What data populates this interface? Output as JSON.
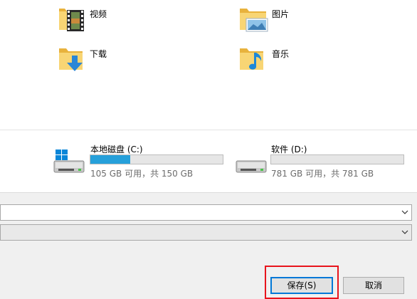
{
  "folders": [
    {
      "label": "视频",
      "icon": "video-folder-icon"
    },
    {
      "label": "图片",
      "icon": "pictures-folder-icon"
    },
    {
      "label": "下载",
      "icon": "downloads-folder-icon"
    },
    {
      "label": "音乐",
      "icon": "music-folder-icon"
    }
  ],
  "drives": [
    {
      "name": "本地磁盘 (C:)",
      "size": "105 GB 可用，共 150 GB",
      "used_fraction": 0.3,
      "icon": "windows-drive-icon"
    },
    {
      "name": "软件 (D:)",
      "size": "781 GB 可用，共 781 GB",
      "used_fraction": 0.0,
      "icon": "drive-icon"
    }
  ],
  "dialog": {
    "filename_value": "",
    "filetype_value": "",
    "save_label": "保存(S)",
    "cancel_label": "取消"
  },
  "colors": {
    "accent": "#0078d7",
    "bar_fill": "#26a0da",
    "highlight": "#e8141c",
    "folder": "#f5c65a"
  }
}
